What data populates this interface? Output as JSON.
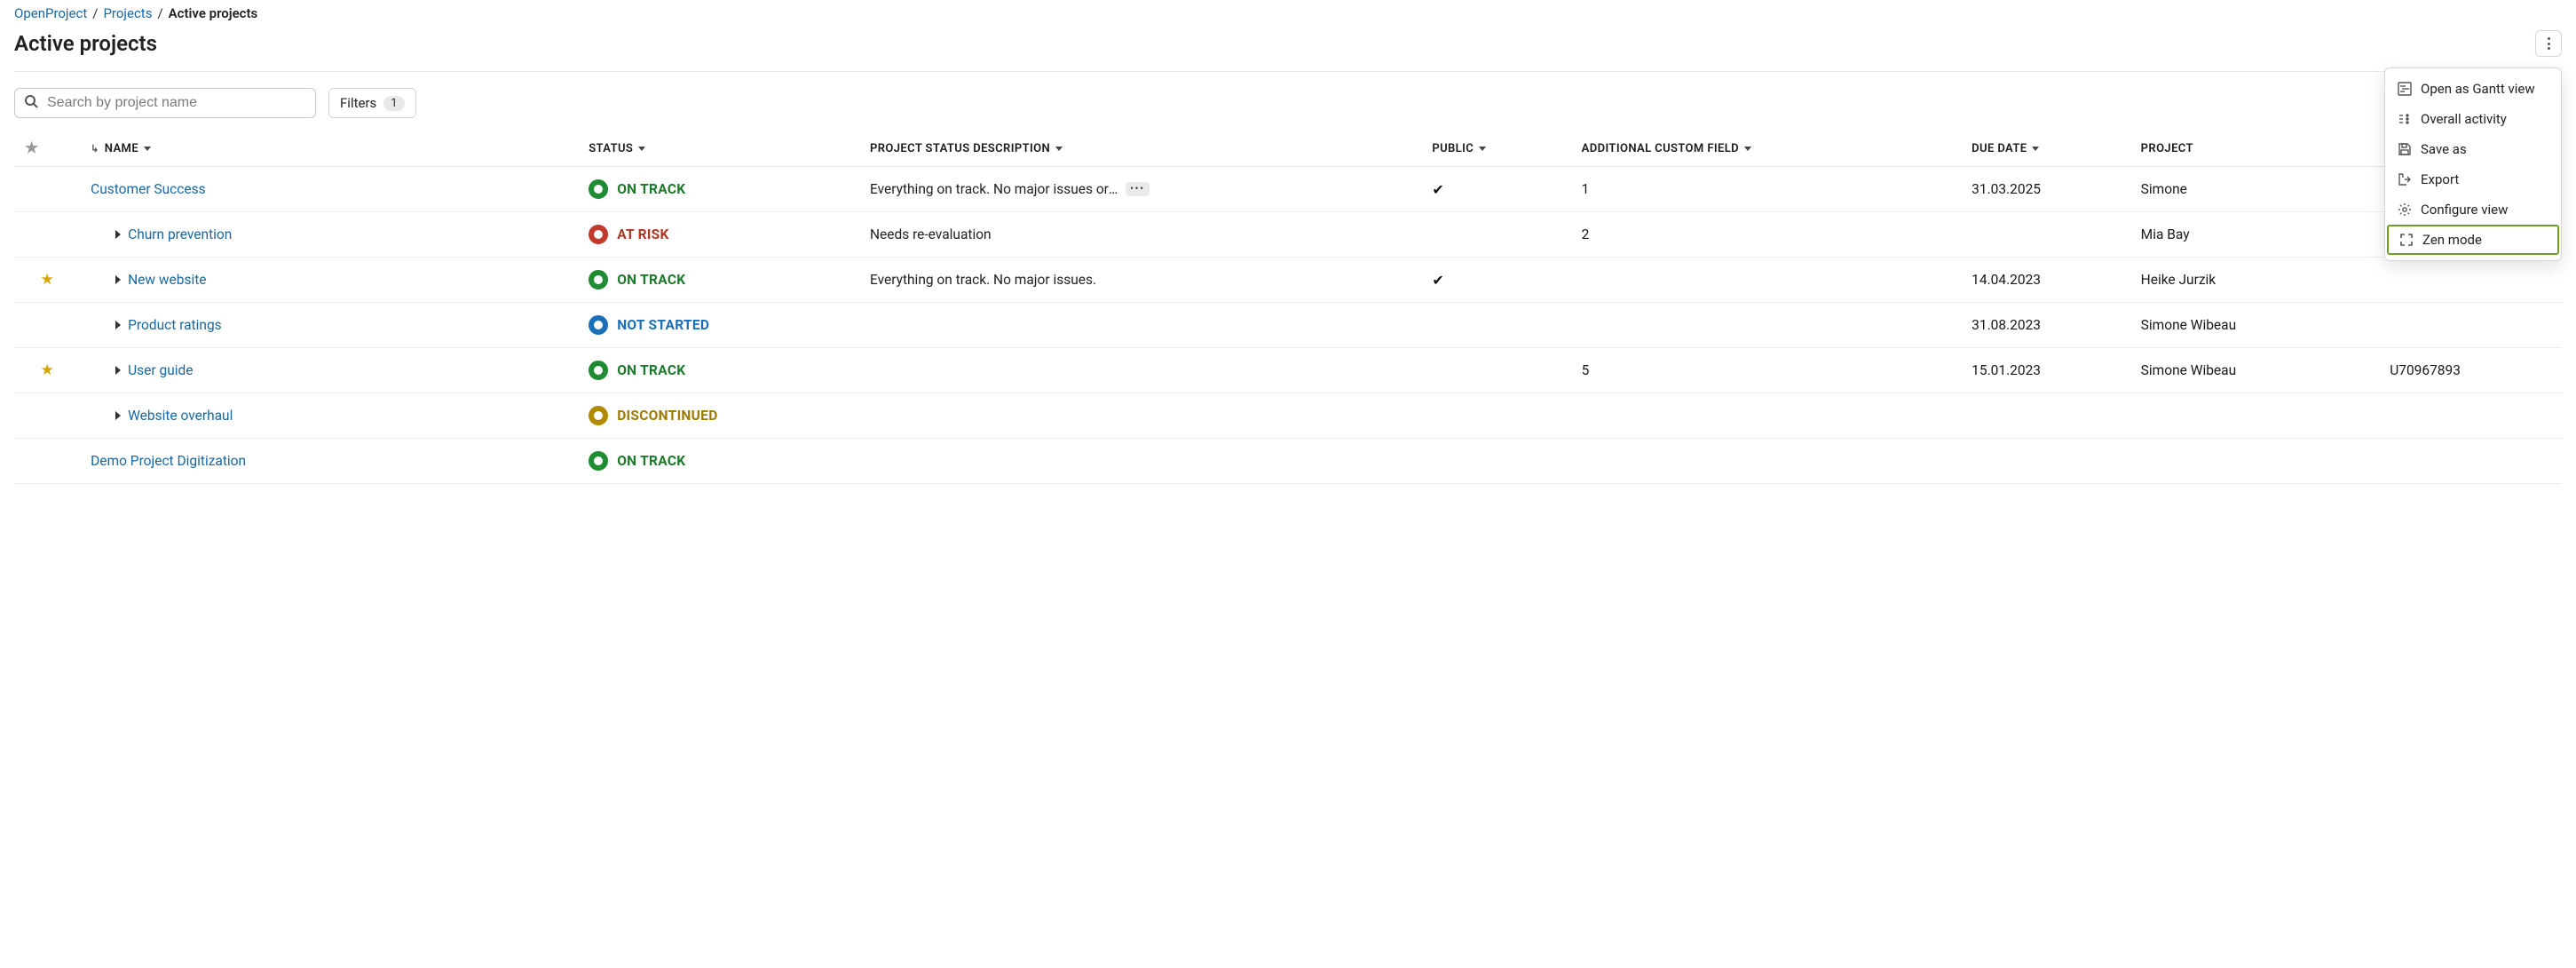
{
  "breadcrumb": {
    "root": "OpenProject",
    "projects": "Projects",
    "current": "Active projects"
  },
  "header": {
    "title": "Active projects"
  },
  "toolbar": {
    "search_placeholder": "Search by project name",
    "filters_label": "Filters",
    "filters_count": "1"
  },
  "columns": {
    "name": "Name",
    "status": "Status",
    "desc": "Project status description",
    "public": "Public",
    "custom": "Additional Custom Field",
    "due": "Due date",
    "hierarchy": "Project"
  },
  "status_labels": {
    "on_track": "ON TRACK",
    "at_risk": "AT RISK",
    "not_started": "NOT STARTED",
    "discontinued": "DISCONTINUED"
  },
  "rows": [
    {
      "fav": false,
      "indent": 0,
      "expander": false,
      "name": "Customer Success",
      "status": "on_track",
      "desc": "Everything on track. No major issues or b",
      "desc_truncated": true,
      "public": true,
      "custom": "1",
      "due": "31.03.2025",
      "hier": "Simone",
      "u": ""
    },
    {
      "fav": false,
      "indent": 1,
      "expander": true,
      "name": "Churn prevention",
      "status": "at_risk",
      "desc": "Needs re-evaluation",
      "desc_truncated": false,
      "public": false,
      "custom": "2",
      "due": "",
      "hier": "Mia Bay",
      "u": ""
    },
    {
      "fav": true,
      "indent": 1,
      "expander": true,
      "name": "New website",
      "status": "on_track",
      "desc": "Everything on track. No major issues.",
      "desc_truncated": false,
      "public": true,
      "custom": "",
      "due": "14.04.2023",
      "hier": "Heike Jurzik",
      "u": ""
    },
    {
      "fav": false,
      "indent": 1,
      "expander": true,
      "name": "Product ratings",
      "status": "not_started",
      "desc": "",
      "desc_truncated": false,
      "public": false,
      "custom": "",
      "due": "31.08.2023",
      "hier": "Simone Wibeau",
      "u": ""
    },
    {
      "fav": true,
      "indent": 1,
      "expander": true,
      "name": "User guide",
      "status": "on_track",
      "desc": "",
      "desc_truncated": false,
      "public": false,
      "custom": "5",
      "due": "15.01.2023",
      "hier": "Simone Wibeau",
      "u": "U70967893"
    },
    {
      "fav": false,
      "indent": 1,
      "expander": true,
      "name": "Website overhaul",
      "status": "discontinued",
      "desc": "",
      "desc_truncated": false,
      "public": false,
      "custom": "",
      "due": "",
      "hier": "",
      "u": ""
    },
    {
      "fav": false,
      "indent": 0,
      "expander": false,
      "name": "Demo Project Digitization",
      "status": "on_track",
      "desc": "",
      "desc_truncated": false,
      "public": false,
      "custom": "",
      "due": "",
      "hier": "",
      "u": ""
    }
  ],
  "menu": {
    "gantt": "Open as Gantt view",
    "activity": "Overall activity",
    "save": "Save as",
    "export": "Export",
    "configure": "Configure view",
    "zen": "Zen mode"
  }
}
